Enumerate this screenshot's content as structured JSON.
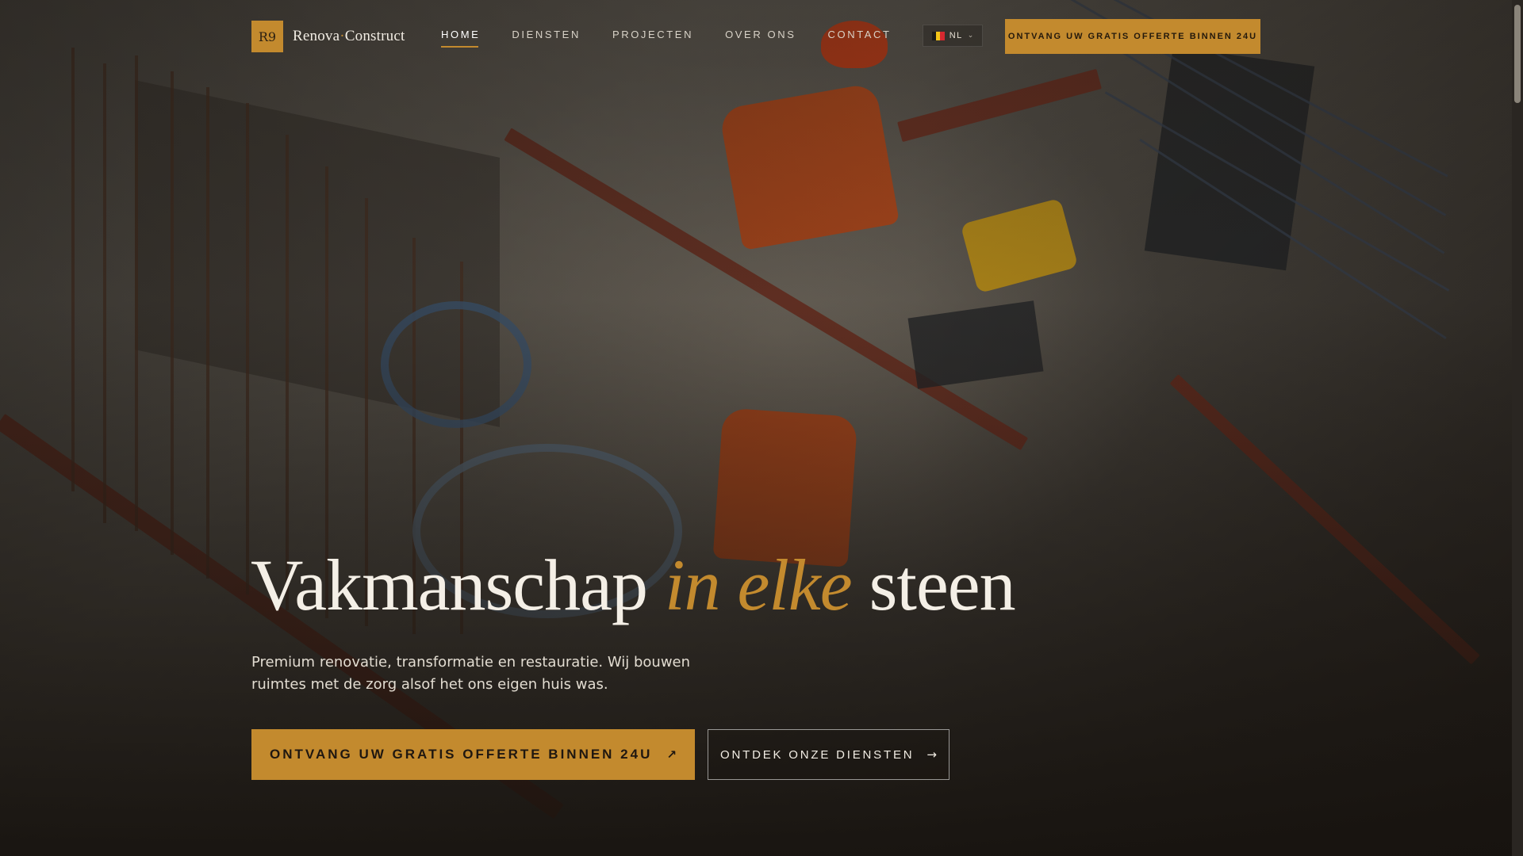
{
  "colors": {
    "accent": "#c38a2e",
    "text_light": "#f2ede4",
    "background_dark": "#1d1a16"
  },
  "logo": {
    "mark": "R9",
    "name_part1": "Renova",
    "separator": "·",
    "name_part2": "Construct"
  },
  "nav": {
    "items": [
      {
        "label": "HOME",
        "active": true
      },
      {
        "label": "DIENSTEN",
        "active": false
      },
      {
        "label": "PROJECTEN",
        "active": false
      },
      {
        "label": "OVER ONS",
        "active": false
      },
      {
        "label": "CONTACT",
        "active": false
      }
    ]
  },
  "language": {
    "code": "NL",
    "flag_icon": "belgium-flag-icon",
    "flag_colors": [
      "#1a1a1a",
      "#f2c318",
      "#d6282f"
    ]
  },
  "header_cta": {
    "label": "ONTVANG UW GRATIS OFFERTE BINNEN 24U"
  },
  "hero": {
    "title_part1": "Vakmanschap",
    "title_accent": "in elke",
    "title_part2": "steen",
    "subtitle": "Premium renovatie, transformatie en restauratie. Wij bouwen ruimtes met de zorg alsof het ons eigen huis was.",
    "primary_button": {
      "label": "ONTVANG UW GRATIS OFFERTE BINNEN 24U",
      "icon": "arrow-up-right-icon",
      "glyph": "↗"
    },
    "secondary_button": {
      "label": "ONTDEK ONZE DIENSTEN",
      "icon": "arrow-right-icon",
      "glyph": "→"
    }
  }
}
